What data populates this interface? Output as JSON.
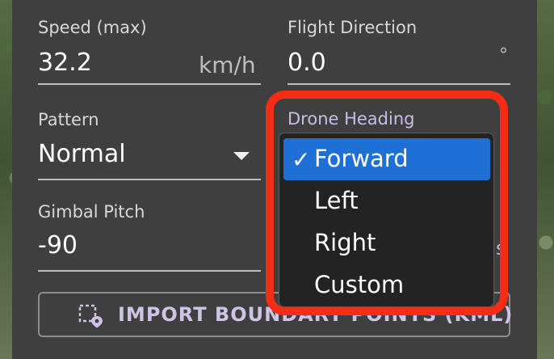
{
  "fields": {
    "speed": {
      "label": "Speed (max)",
      "value": "32.2",
      "unit": "km/h"
    },
    "flight_direction": {
      "label": "Flight Direction",
      "value": "0.0",
      "unit": "°"
    },
    "pattern": {
      "label": "Pattern",
      "value": "Normal"
    },
    "gimbal_pitch": {
      "label": "Gimbal Pitch",
      "value": "-90",
      "unit_partial": "s"
    }
  },
  "drone_heading": {
    "label": "Drone Heading",
    "options": [
      {
        "label": "Forward",
        "selected": true
      },
      {
        "label": "Left",
        "selected": false
      },
      {
        "label": "Right",
        "selected": false
      },
      {
        "label": "Custom",
        "selected": false
      }
    ],
    "check_glyph": "✓"
  },
  "import_button": {
    "label": "IMPORT BOUNDARY POINTS (KML)",
    "icon": "import-kml-icon"
  },
  "colors": {
    "accent": "#1e70d7",
    "highlight": "#f52d16",
    "label_purple": "#c9bde6"
  }
}
